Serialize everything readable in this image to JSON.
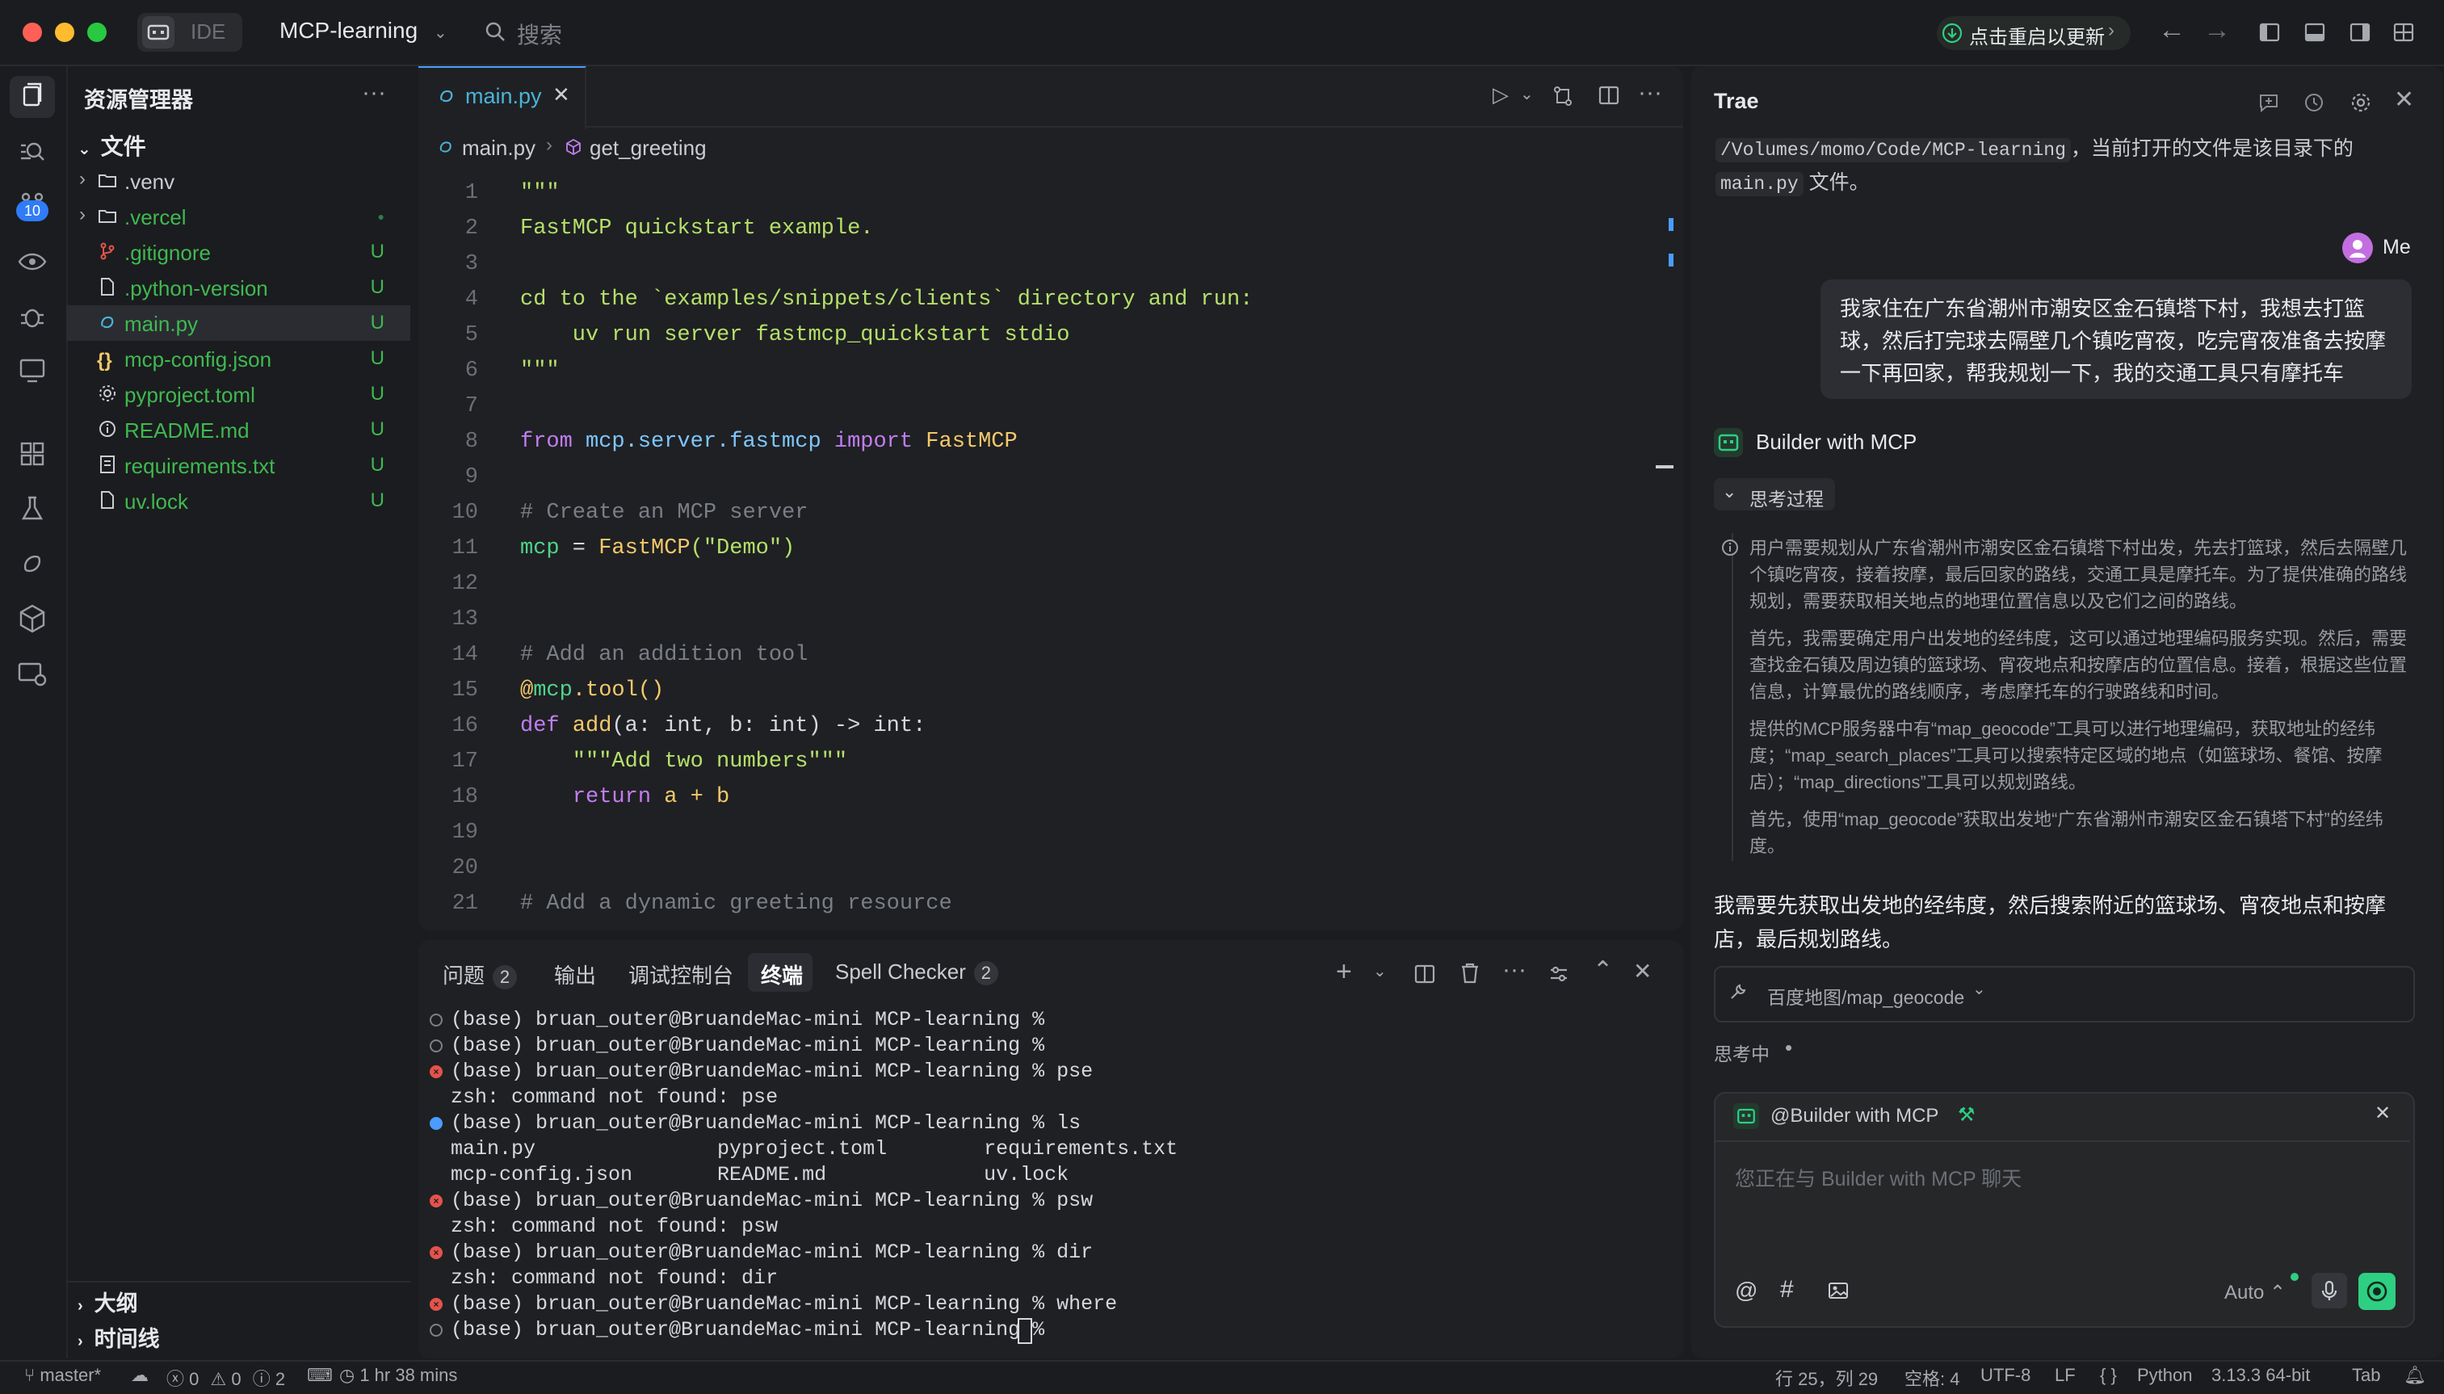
{
  "titlebar": {
    "ide_label": "IDE",
    "project": "MCP-learning",
    "search_placeholder": "搜索",
    "update_label": "点击重启以更新"
  },
  "activity": {
    "scm_badge": "10"
  },
  "explorer": {
    "title": "资源管理器",
    "section": "文件",
    "items": [
      {
        "name": ".venv",
        "kind": "folder",
        "badge": ""
      },
      {
        "name": ".vercel",
        "kind": "folder",
        "badge": "●"
      },
      {
        "name": ".gitignore",
        "kind": "git",
        "badge": "U"
      },
      {
        "name": ".python-version",
        "kind": "file",
        "badge": "U"
      },
      {
        "name": "main.py",
        "kind": "python",
        "badge": "U"
      },
      {
        "name": "mcp-config.json",
        "kind": "json",
        "badge": "U"
      },
      {
        "name": "pyproject.toml",
        "kind": "gear",
        "badge": "U"
      },
      {
        "name": "README.md",
        "kind": "info",
        "badge": "U"
      },
      {
        "name": "requirements.txt",
        "kind": "list",
        "badge": "U"
      },
      {
        "name": "uv.lock",
        "kind": "file",
        "badge": "U"
      }
    ],
    "outline": "大纲",
    "timeline": "时间线"
  },
  "editor": {
    "tab": "main.py",
    "breadcrumb_file": "main.py",
    "breadcrumb_symbol": "get_greeting",
    "line_numbers": [
      "1",
      "2",
      "3",
      "4",
      "5",
      "6",
      "7",
      "8",
      "9",
      "10",
      "11",
      "12",
      "13",
      "14",
      "15",
      "16",
      "17",
      "18",
      "19",
      "20",
      "21"
    ],
    "code": {
      "l1": "\"\"\"",
      "l2": "FastMCP quickstart example.",
      "l4": "cd to the `examples/snippets/clients` directory and run:",
      "l5": "    uv run server fastmcp_quickstart stdio",
      "l6": "\"\"\"",
      "l8_from": "from",
      "l8_mod": "mcp.server.fastmcp",
      "l8_import": "import",
      "l8_name": "FastMCP",
      "l10": "# Create an MCP server",
      "l11_var": "mcp",
      "l11_eq": " = ",
      "l11_fn": "FastMCP",
      "l11_arg": "(\"Demo\")",
      "l14": "# Add an addition tool",
      "l15_at": "@",
      "l15_mcp": "mcp",
      "l15_tool": ".tool()",
      "l16_def": "def",
      "l16_fn": "add",
      "l16_rest": "(a: int, b: int) -> int:",
      "l17": "    \"\"\"Add two numbers\"\"\"",
      "l18_ret": "return",
      "l18_rest": " a + b",
      "l21": "# Add a dynamic greeting resource"
    }
  },
  "panel": {
    "tabs": [
      {
        "label": "问题",
        "badge": "2"
      },
      {
        "label": "输出",
        "badge": ""
      },
      {
        "label": "调试控制台",
        "badge": ""
      },
      {
        "label": "终端",
        "badge": ""
      },
      {
        "label": "Spell Checker",
        "badge": "2"
      }
    ],
    "terminal": [
      {
        "dot": "empty",
        "text": "(base) bruan_outer@BruandeMac-mini MCP-learning %"
      },
      {
        "dot": "empty",
        "text": "(base) bruan_outer@BruandeMac-mini MCP-learning %"
      },
      {
        "dot": "error",
        "text": "(base) bruan_outer@BruandeMac-mini MCP-learning % pse"
      },
      {
        "dot": "none",
        "text": "zsh: command not found: pse"
      },
      {
        "dot": "info",
        "text": "(base) bruan_outer@BruandeMac-mini MCP-learning % ls"
      },
      {
        "dot": "none",
        "text": "main.py               pyproject.toml        requirements.txt"
      },
      {
        "dot": "none",
        "text": "mcp-config.json       README.md             uv.lock"
      },
      {
        "dot": "error",
        "text": "(base) bruan_outer@BruandeMac-mini MCP-learning % psw"
      },
      {
        "dot": "none",
        "text": "zsh: command not found: psw"
      },
      {
        "dot": "error",
        "text": "(base) bruan_outer@BruandeMac-mini MCP-learning % dir"
      },
      {
        "dot": "none",
        "text": "zsh: command not found: dir"
      },
      {
        "dot": "error",
        "text": "(base) bruan_outer@BruandeMac-mini MCP-learning % where"
      },
      {
        "dot": "empty",
        "text": "(base) bruan_outer@BruandeMac-mini MCP-learning % "
      }
    ]
  },
  "chat": {
    "title": "Trae",
    "prev_path": "/Volumes/momo/Code/MCP-learning",
    "prev_text": "，当前打开的文件是该目录下的",
    "prev_file": "main.py",
    "prev_suffix": "文件。",
    "me_label": "Me",
    "user_message": "我家住在广东省潮州市潮安区金石镇塔下村，我想去打篮球，然后打完球去隔壁几个镇吃宵夜，吃完宵夜准备去按摩一下再回家，帮我规划一下，我的交通工具只有摩托车",
    "agent_name": "Builder with MCP",
    "thinking_label": "思考过程",
    "thoughts": [
      "用户需要规划从广东省潮州市潮安区金石镇塔下村出发，先去打篮球，然后去隔壁几个镇吃宵夜，接着按摩，最后回家的路线，交通工具是摩托车。为了提供准确的路线规划，需要获取相关地点的地理位置信息以及它们之间的路线。",
      "首先，我需要确定用户出发地的经纬度，这可以通过地理编码服务实现。然后，需要查找金石镇及周边镇的篮球场、宵夜地点和按摩店的位置信息。接着，根据这些位置信息，计算最优的路线顺序，考虑摩托车的行驶路线和时间。",
      "提供的MCP服务器中有“map_geocode”工具可以进行地理编码，获取地址的经纬度；“map_search_places”工具可以搜索特定区域的地点（如篮球场、餐馆、按摩店）；“map_directions”工具可以规划路线。",
      "首先，使用“map_geocode”获取出发地“广东省潮州市潮安区金石镇塔下村”的经纬度。"
    ],
    "response": "我需要先获取出发地的经纬度，然后搜索附近的篮球场、宵夜地点和按摩店，最后规划路线。",
    "tool_call": "百度地图/map_geocode",
    "status": "思考中",
    "input_agent": "@Builder with MCP",
    "input_placeholder": "您正在与 Builder with MCP 聊天",
    "model": "Auto"
  },
  "statusbar": {
    "branch": "master*",
    "errors": "0",
    "warnings": "0",
    "infos": "2",
    "time": "1 hr 38 mins",
    "position": "行 25，列 29",
    "spaces": "空格: 4",
    "encoding": "UTF-8",
    "eol": "LF",
    "language": "Python",
    "interpreter": "3.13.3 64-bit",
    "tab": "Tab"
  },
  "colors": {
    "accent": "#4a9cff",
    "untracked": "#3fb950",
    "error": "#e5534b",
    "send": "#2ecf83"
  }
}
